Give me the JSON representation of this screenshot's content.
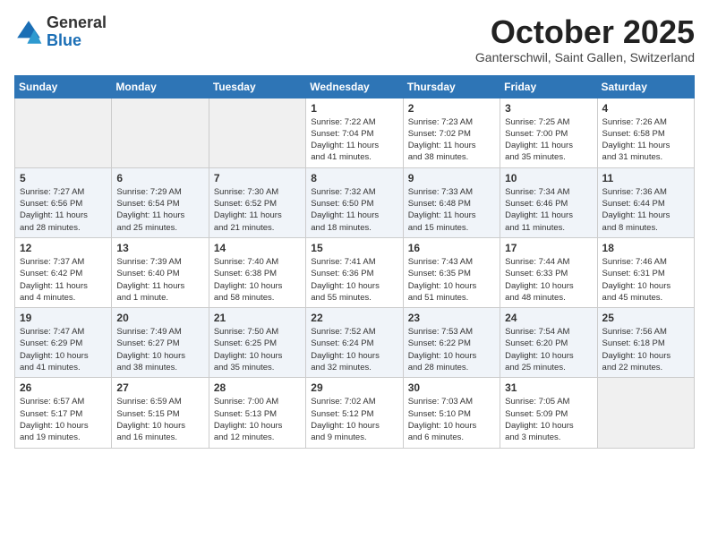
{
  "header": {
    "logo_general": "General",
    "logo_blue": "Blue",
    "month": "October 2025",
    "location": "Ganterschwil, Saint Gallen, Switzerland"
  },
  "weekdays": [
    "Sunday",
    "Monday",
    "Tuesday",
    "Wednesday",
    "Thursday",
    "Friday",
    "Saturday"
  ],
  "weeks": [
    [
      {
        "day": "",
        "info": ""
      },
      {
        "day": "",
        "info": ""
      },
      {
        "day": "",
        "info": ""
      },
      {
        "day": "1",
        "info": "Sunrise: 7:22 AM\nSunset: 7:04 PM\nDaylight: 11 hours\nand 41 minutes."
      },
      {
        "day": "2",
        "info": "Sunrise: 7:23 AM\nSunset: 7:02 PM\nDaylight: 11 hours\nand 38 minutes."
      },
      {
        "day": "3",
        "info": "Sunrise: 7:25 AM\nSunset: 7:00 PM\nDaylight: 11 hours\nand 35 minutes."
      },
      {
        "day": "4",
        "info": "Sunrise: 7:26 AM\nSunset: 6:58 PM\nDaylight: 11 hours\nand 31 minutes."
      }
    ],
    [
      {
        "day": "5",
        "info": "Sunrise: 7:27 AM\nSunset: 6:56 PM\nDaylight: 11 hours\nand 28 minutes."
      },
      {
        "day": "6",
        "info": "Sunrise: 7:29 AM\nSunset: 6:54 PM\nDaylight: 11 hours\nand 25 minutes."
      },
      {
        "day": "7",
        "info": "Sunrise: 7:30 AM\nSunset: 6:52 PM\nDaylight: 11 hours\nand 21 minutes."
      },
      {
        "day": "8",
        "info": "Sunrise: 7:32 AM\nSunset: 6:50 PM\nDaylight: 11 hours\nand 18 minutes."
      },
      {
        "day": "9",
        "info": "Sunrise: 7:33 AM\nSunset: 6:48 PM\nDaylight: 11 hours\nand 15 minutes."
      },
      {
        "day": "10",
        "info": "Sunrise: 7:34 AM\nSunset: 6:46 PM\nDaylight: 11 hours\nand 11 minutes."
      },
      {
        "day": "11",
        "info": "Sunrise: 7:36 AM\nSunset: 6:44 PM\nDaylight: 11 hours\nand 8 minutes."
      }
    ],
    [
      {
        "day": "12",
        "info": "Sunrise: 7:37 AM\nSunset: 6:42 PM\nDaylight: 11 hours\nand 4 minutes."
      },
      {
        "day": "13",
        "info": "Sunrise: 7:39 AM\nSunset: 6:40 PM\nDaylight: 11 hours\nand 1 minute."
      },
      {
        "day": "14",
        "info": "Sunrise: 7:40 AM\nSunset: 6:38 PM\nDaylight: 10 hours\nand 58 minutes."
      },
      {
        "day": "15",
        "info": "Sunrise: 7:41 AM\nSunset: 6:36 PM\nDaylight: 10 hours\nand 55 minutes."
      },
      {
        "day": "16",
        "info": "Sunrise: 7:43 AM\nSunset: 6:35 PM\nDaylight: 10 hours\nand 51 minutes."
      },
      {
        "day": "17",
        "info": "Sunrise: 7:44 AM\nSunset: 6:33 PM\nDaylight: 10 hours\nand 48 minutes."
      },
      {
        "day": "18",
        "info": "Sunrise: 7:46 AM\nSunset: 6:31 PM\nDaylight: 10 hours\nand 45 minutes."
      }
    ],
    [
      {
        "day": "19",
        "info": "Sunrise: 7:47 AM\nSunset: 6:29 PM\nDaylight: 10 hours\nand 41 minutes."
      },
      {
        "day": "20",
        "info": "Sunrise: 7:49 AM\nSunset: 6:27 PM\nDaylight: 10 hours\nand 38 minutes."
      },
      {
        "day": "21",
        "info": "Sunrise: 7:50 AM\nSunset: 6:25 PM\nDaylight: 10 hours\nand 35 minutes."
      },
      {
        "day": "22",
        "info": "Sunrise: 7:52 AM\nSunset: 6:24 PM\nDaylight: 10 hours\nand 32 minutes."
      },
      {
        "day": "23",
        "info": "Sunrise: 7:53 AM\nSunset: 6:22 PM\nDaylight: 10 hours\nand 28 minutes."
      },
      {
        "day": "24",
        "info": "Sunrise: 7:54 AM\nSunset: 6:20 PM\nDaylight: 10 hours\nand 25 minutes."
      },
      {
        "day": "25",
        "info": "Sunrise: 7:56 AM\nSunset: 6:18 PM\nDaylight: 10 hours\nand 22 minutes."
      }
    ],
    [
      {
        "day": "26",
        "info": "Sunrise: 6:57 AM\nSunset: 5:17 PM\nDaylight: 10 hours\nand 19 minutes."
      },
      {
        "day": "27",
        "info": "Sunrise: 6:59 AM\nSunset: 5:15 PM\nDaylight: 10 hours\nand 16 minutes."
      },
      {
        "day": "28",
        "info": "Sunrise: 7:00 AM\nSunset: 5:13 PM\nDaylight: 10 hours\nand 12 minutes."
      },
      {
        "day": "29",
        "info": "Sunrise: 7:02 AM\nSunset: 5:12 PM\nDaylight: 10 hours\nand 9 minutes."
      },
      {
        "day": "30",
        "info": "Sunrise: 7:03 AM\nSunset: 5:10 PM\nDaylight: 10 hours\nand 6 minutes."
      },
      {
        "day": "31",
        "info": "Sunrise: 7:05 AM\nSunset: 5:09 PM\nDaylight: 10 hours\nand 3 minutes."
      },
      {
        "day": "",
        "info": ""
      }
    ]
  ]
}
